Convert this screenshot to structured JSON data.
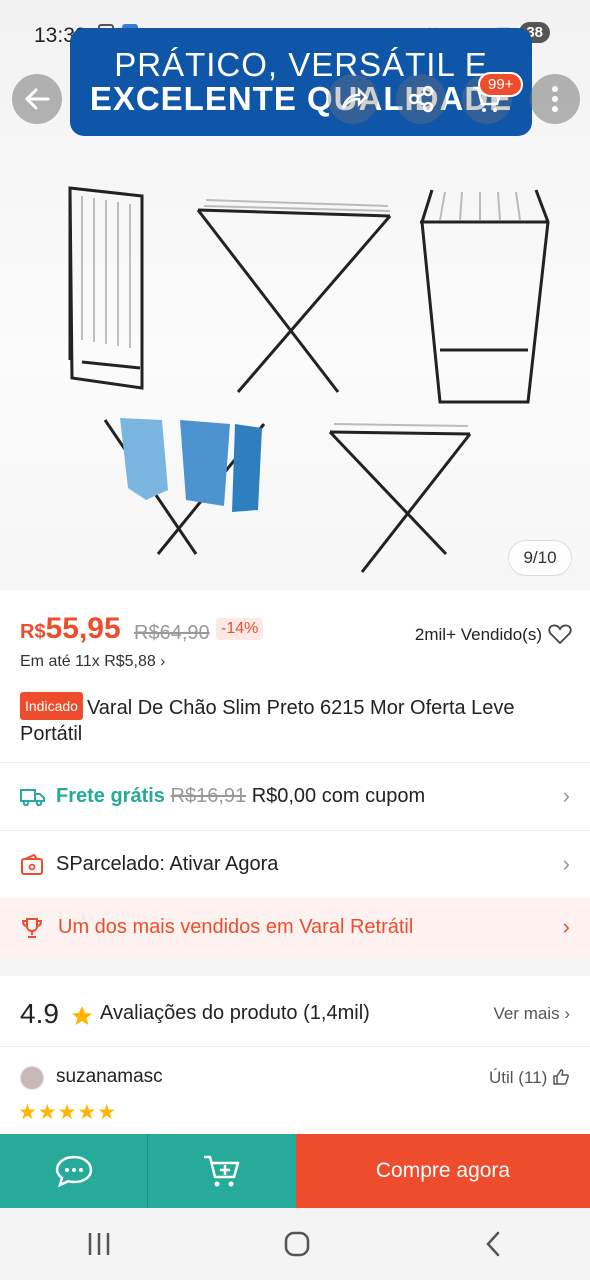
{
  "status_bar": {
    "time": "13:39",
    "battery": "38"
  },
  "banner": {
    "line1": "PRÁTICO, VERSÁTIL E",
    "line2": "EXCELENTE QUALIDADE"
  },
  "header": {
    "cart_badge": "99+"
  },
  "gallery": {
    "counter": "9/10"
  },
  "product": {
    "currency": "R$",
    "price": "55,95",
    "old_price": "R$64,90",
    "discount": "-14%",
    "sold": "2mil+ Vendido(s)",
    "installments": "Em até 11x R$5,88",
    "tag": "Indicado",
    "title": "Varal De Chão Slim Preto 6215 Mor Oferta Leve Portátil"
  },
  "shipping": {
    "label": "Frete grátis",
    "old_price": "R$16,91",
    "new_price": "R$0,00 com cupom"
  },
  "sparcelado": {
    "label": "SParcelado: Ativar Agora"
  },
  "top_seller": {
    "label": "Um dos mais vendidos em Varal Retrátil"
  },
  "reviews": {
    "rating": "4.9",
    "title": "Avaliações do produto",
    "count": "(1,4mil)",
    "see_more": "Ver mais",
    "first_review": {
      "user": "suzanamasc",
      "useful": "Útil (11)",
      "stars": "★★★★★"
    }
  },
  "bottom_bar": {
    "buy_label": "Compre agora"
  },
  "colors": {
    "brand": "#ee4d2d",
    "teal": "#26aa99",
    "banner_blue": "#0f55a8"
  }
}
